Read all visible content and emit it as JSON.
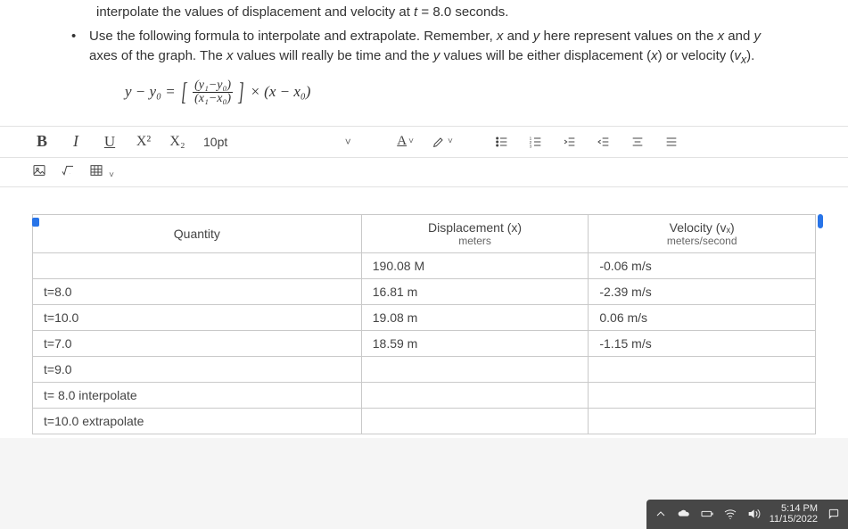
{
  "doc": {
    "line1_pre": "interpolate the values of displacement and velocity at ",
    "line1_var": "t",
    "line1_post": " = 8.0 seconds.",
    "bullet": "•",
    "line2_a": "Use the following formula to interpolate and extrapolate. Remember, ",
    "line2_x": "x",
    "line2_b": " and ",
    "line2_y": "y",
    "line2_c": " here represent values on the ",
    "line2_d": " and ",
    "line2_e": " axes of the graph. The ",
    "line2_f": " values will really be time and the ",
    "line2_g": " values will be either displacement (",
    "line2_h": ") or velocity (",
    "line2_vx": "v",
    "line2_vx_sub": "x",
    "line2_i": ").",
    "formula_lhs": "y − y₀ = ",
    "formula_num": "(y₁−y₀)",
    "formula_den": "(x₁−x₀)",
    "formula_rhs": " × (x − x₀)"
  },
  "toolbar": {
    "bold": "B",
    "italic": "I",
    "underline": "U",
    "superscript": "X²",
    "subscript": "X₂",
    "font_size": "10pt",
    "text_color_label": "A"
  },
  "table": {
    "headers": {
      "quantity": "Quantity",
      "disp_title": "Displacement (x)",
      "disp_sub": "meters",
      "vel_title": "Velocity (vₓ)",
      "vel_sub": "meters/second"
    },
    "rows": [
      {
        "q": "",
        "d": "190.08 M",
        "v": "-0.06 m/s"
      },
      {
        "q": "t=8.0",
        "d": "16.81 m",
        "v": "-2.39 m/s"
      },
      {
        "q": "t=10.0",
        "d": "19.08 m",
        "v": "0.06 m/s"
      },
      {
        "q": "t=7.0",
        "d": "18.59 m",
        "v": "-1.15 m/s"
      },
      {
        "q": "t=9.0",
        "d": "",
        "v": ""
      },
      {
        "q": "t= 8.0 interpolate",
        "d": "",
        "v": ""
      },
      {
        "q": "t=10.0 extrapolate",
        "d": "",
        "v": ""
      }
    ]
  },
  "taskbar": {
    "time": "5:14 PM",
    "date": "11/15/2022"
  }
}
